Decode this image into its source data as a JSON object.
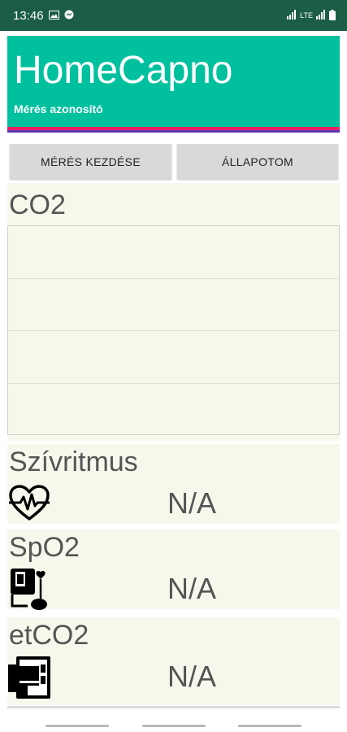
{
  "status_bar": {
    "time": "13:46",
    "network": "LTE",
    "icons": [
      "image-icon",
      "messenger-icon",
      "signal-icon",
      "signal-icon",
      "battery-icon"
    ]
  },
  "header": {
    "title": "HomeCapno",
    "subtitle": "Mérés azonosító"
  },
  "buttons": {
    "start": "MÉRÉS KEZDÉSE",
    "status": "ÁLLAPOTOM"
  },
  "co2": {
    "label": "CO2"
  },
  "metrics": {
    "heart_rate": {
      "label": "Szívritmus",
      "value": "N/A",
      "icon": "heart-rate-icon"
    },
    "spo2": {
      "label": "SpO2",
      "value": "N/A",
      "icon": "blood-pressure-icon"
    },
    "etco2": {
      "label": "etCO2",
      "value": "N/A",
      "icon": "device-icon"
    }
  },
  "colors": {
    "status_bar": "#1b5e45",
    "header": "#00c09e",
    "header_accent": "#e91e63",
    "panel": "#f7f8ec"
  }
}
